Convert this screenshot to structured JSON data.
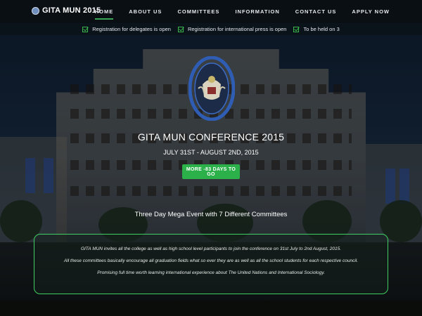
{
  "nav": {
    "logo_text": "GITA MUN 2015",
    "items": [
      {
        "label": "HOME",
        "active": true
      },
      {
        "label": "ABOUT US"
      },
      {
        "label": "COMMITTEES"
      },
      {
        "label": "INFORMATION"
      },
      {
        "label": "CONTACT US"
      },
      {
        "label": "APPLY NOW"
      }
    ]
  },
  "ticker": {
    "items": [
      "Registration for delegates is open",
      "Registration for international press is open",
      "To be held on 3"
    ]
  },
  "hero": {
    "title": "GITA MUN CONFERENCE 2015",
    "date": "JULY 31ST - AUGUST 2ND, 2015",
    "cta_label": "MORE -83 DAYS TO GO",
    "tagline": "Three Day Mega Event with 7 Different Committees"
  },
  "info": {
    "lines": [
      "GITA MUN invites all the college as well as high school level participants to join the conference on 31st July to 2nd August, 2015.",
      "All these committees basically encourage all graduation fields what so ever they are as well as all the school students for each respective council.",
      "Promising full time worth learning international experience about The United Nations and International Sociology."
    ]
  },
  "colors": {
    "accent_green": "#2bb04a",
    "nav_bg": "#0a0f14",
    "emblem_blue": "#2f5db3"
  }
}
